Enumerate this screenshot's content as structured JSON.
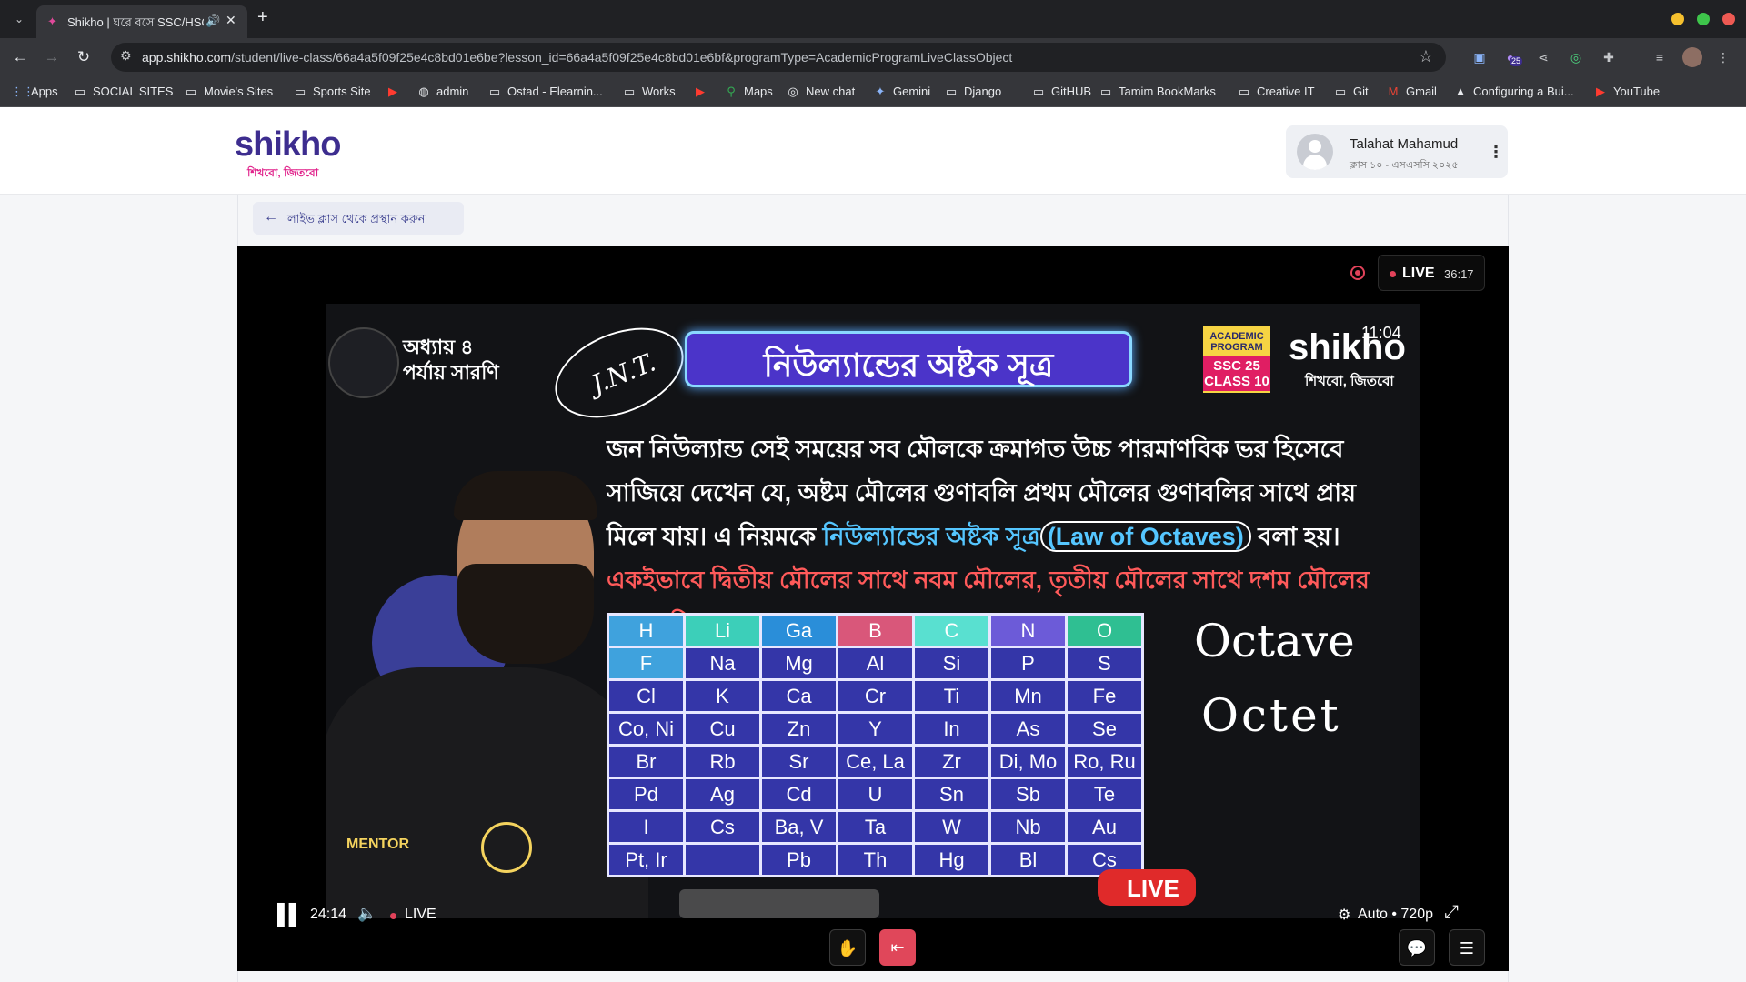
{
  "browser": {
    "tab": {
      "title": "Shikho | ঘরে বসে SSC/HSC",
      "favicon": "shikho-favicon-icon"
    },
    "url": {
      "host": "app.shikho.com",
      "path": "/student/live-class/66a4a5f09f25e4c8bd01e6be?lesson_id=66a4a5f09f25e4c8bd01e6bf&programType=AcademicProgramLiveClassObject"
    },
    "bookmarks": [
      {
        "label": "Apps",
        "icon": "apps-grid-icon"
      },
      {
        "label": "SOCIAL SITES",
        "icon": "folder-icon"
      },
      {
        "label": "Movie's Sites",
        "icon": "folder-icon"
      },
      {
        "label": "Sports Site",
        "icon": "folder-icon"
      },
      {
        "label": "",
        "icon": "youtube-icon"
      },
      {
        "label": "admin",
        "icon": "globe-icon"
      },
      {
        "label": "Ostad - Elearnin...",
        "icon": "folder-icon"
      },
      {
        "label": "Works",
        "icon": "folder-icon"
      },
      {
        "label": "",
        "icon": "youtube-icon"
      },
      {
        "label": "Maps",
        "icon": "maps-pin-icon"
      },
      {
        "label": "New chat",
        "icon": "chatgpt-icon"
      },
      {
        "label": "Gemini",
        "icon": "gemini-sparkle-icon"
      },
      {
        "label": "Django",
        "icon": "folder-icon"
      },
      {
        "label": "GitHUB",
        "icon": "folder-icon"
      },
      {
        "label": "Tamim BookMarks",
        "icon": "folder-icon"
      },
      {
        "label": "Creative IT",
        "icon": "folder-icon"
      },
      {
        "label": "Git",
        "icon": "folder-icon"
      },
      {
        "label": "Gmail",
        "icon": "gmail-icon"
      },
      {
        "label": "Configuring a Bui...",
        "icon": "vercel-triangle-icon"
      },
      {
        "label": "YouTube",
        "icon": "youtube-icon"
      }
    ],
    "extension_badge": "25"
  },
  "header": {
    "logo": {
      "main": "shikho",
      "tagline": "শিখবো, জিতবো"
    },
    "user": {
      "name": "Talahat Mahamud",
      "class_info": "ক্লাস ১০ - এসএসসি ২০২৫"
    }
  },
  "back_button": {
    "label": "লাইভ ক্লাস থেকে প্রস্থান করুন"
  },
  "player": {
    "live_label": "LIVE",
    "live_elapsed": "36:17",
    "current_time": "24:14",
    "control_live_label": "LIVE",
    "quality": "Auto • 720p"
  },
  "video_frame": {
    "chapter": "অধ্যায় ৪\nপর্যায় সারণি",
    "title": "নিউল্যান্ডের অষ্টক সূত্র",
    "annotation_jnt": "J.N.T.",
    "badge_top": "ACADEMIC PROGRAM",
    "badge_bottom": "SSC 25\nCLASS 10",
    "logo": "shikho",
    "logo_tagline": "শিখবো, জিতবো",
    "clock": "11:04",
    "para_1": "জন নিউল্যান্ড সেই সময়ের সব মৌলকে ক্রমাগত উচ্চ পারমাণবিক ভর হিসেবে সাজিয়ে দেখেন যে, অষ্টম মৌলের গুণাবলি প্রথম মৌলের গুণাবলির সাথে প্রায় মিলে যায়। এ নিয়মকে ",
    "para_law_bn": "নিউল্যান্ডের অষ্টক সূত্র",
    "para_law_en": "(Law of Octaves)",
    "para_2": " বলা হয়। ",
    "para_3": "একইভাবে দ্বিতীয় মৌলের সাথে নবম মৌলের, তৃতীয় মৌলের সাথে দশম মৌলের পুরোপুরি সাদৃশ্য লক্ষ করা যায়।",
    "table": [
      [
        "H",
        "Li",
        "Ga",
        "B",
        "C",
        "N",
        "O"
      ],
      [
        "F",
        "Na",
        "Mg",
        "Al",
        "Si",
        "P",
        "S"
      ],
      [
        "Cl",
        "K",
        "Ca",
        "Cr",
        "Ti",
        "Mn",
        "Fe"
      ],
      [
        "Co, Ni",
        "Cu",
        "Zn",
        "Y",
        "In",
        "As",
        "Se"
      ],
      [
        "Br",
        "Rb",
        "Sr",
        "Ce, La",
        "Zr",
        "Di, Mo",
        "Ro, Ru"
      ],
      [
        "Pd",
        "Ag",
        "Cd",
        "U",
        "Sn",
        "Sb",
        "Te"
      ],
      [
        "I",
        "Cs",
        "Ba, V",
        "Ta",
        "W",
        "Nb",
        "Au"
      ],
      [
        "Pt, Ir",
        "",
        "Pb",
        "Th",
        "Hg",
        "Bl",
        "Cs"
      ]
    ],
    "handwritten_1": "Octave",
    "handwritten_2": "Octet",
    "mentor_label": "MENTOR",
    "live_badge": "LIVE"
  }
}
